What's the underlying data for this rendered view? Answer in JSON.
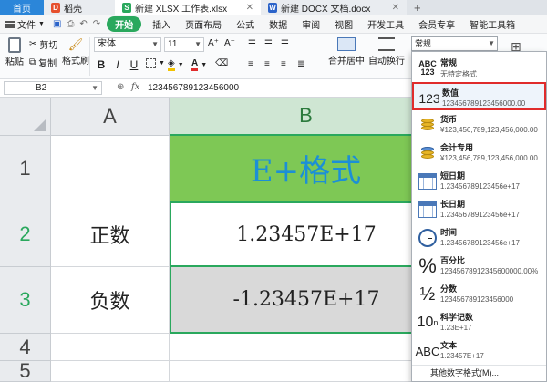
{
  "titlebar": {
    "home": "首页",
    "tabs": [
      {
        "label": "稻壳"
      },
      {
        "label": "新建 XLSX 工作表.xlsx"
      },
      {
        "label": "新建 DOCX 文档.docx"
      }
    ]
  },
  "menubar": {
    "file": "文件",
    "start": "开始",
    "items": [
      "插入",
      "页面布局",
      "公式",
      "数据",
      "审阅",
      "视图",
      "开发工具",
      "会员专享",
      "智能工具箱"
    ]
  },
  "toolbar": {
    "paste": "粘贴",
    "cut": "剪切",
    "copy": "复制",
    "format_painter": "格式刷",
    "font_name": "宋体",
    "font_size": "11",
    "bold": "B",
    "italic": "I",
    "underline": "U",
    "merge": "合并居中",
    "wrap": "自动换行",
    "number_format": "常规"
  },
  "formulabar": {
    "cell_ref": "B2",
    "fx": "fx",
    "value": "123456789123456000"
  },
  "sheet": {
    "columns": [
      "A",
      "B"
    ],
    "rows": [
      "1",
      "2",
      "3",
      "4",
      "5"
    ],
    "b1": "E+格式",
    "a2": "正数",
    "b2": "1.23457E+17",
    "a3": "负数",
    "b3": "-1.23457E+17"
  },
  "format_menu": {
    "items": [
      {
        "name": "常规",
        "example": "无特定格式",
        "icon": "abc-123-icon"
      },
      {
        "name": "数值",
        "example": "123456789123456000.00",
        "icon": "number-123-icon"
      },
      {
        "name": "货币",
        "example": "¥123,456,789,123,456,000.00",
        "icon": "currency-coins-icon"
      },
      {
        "name": "会计专用",
        "example": "¥123,456,789,123,456,000.00",
        "icon": "accounting-coins-icon"
      },
      {
        "name": "短日期",
        "example": "1.23456789123456e+17",
        "icon": "short-date-calendar-icon"
      },
      {
        "name": "长日期",
        "example": "1.23456789123456e+17",
        "icon": "long-date-calendar-icon"
      },
      {
        "name": "时间",
        "example": "1.23456789123456e+17",
        "icon": "clock-icon"
      },
      {
        "name": "百分比",
        "example": "12345678912345600000.00%",
        "icon": "percent-icon"
      },
      {
        "name": "分数",
        "example": "123456789123456000",
        "icon": "fraction-icon"
      },
      {
        "name": "科学记数",
        "example": "1.23E+17",
        "icon": "scientific-icon"
      },
      {
        "name": "文本",
        "example": "1.23457E+17",
        "icon": "text-abc-icon"
      }
    ],
    "more": "其他数字格式(M)..."
  },
  "colors": {
    "accent_green": "#2aa85d",
    "title_fill": "#7ec855",
    "title_text": "#1c8fd6",
    "highlight_red": "#e02b2b"
  }
}
